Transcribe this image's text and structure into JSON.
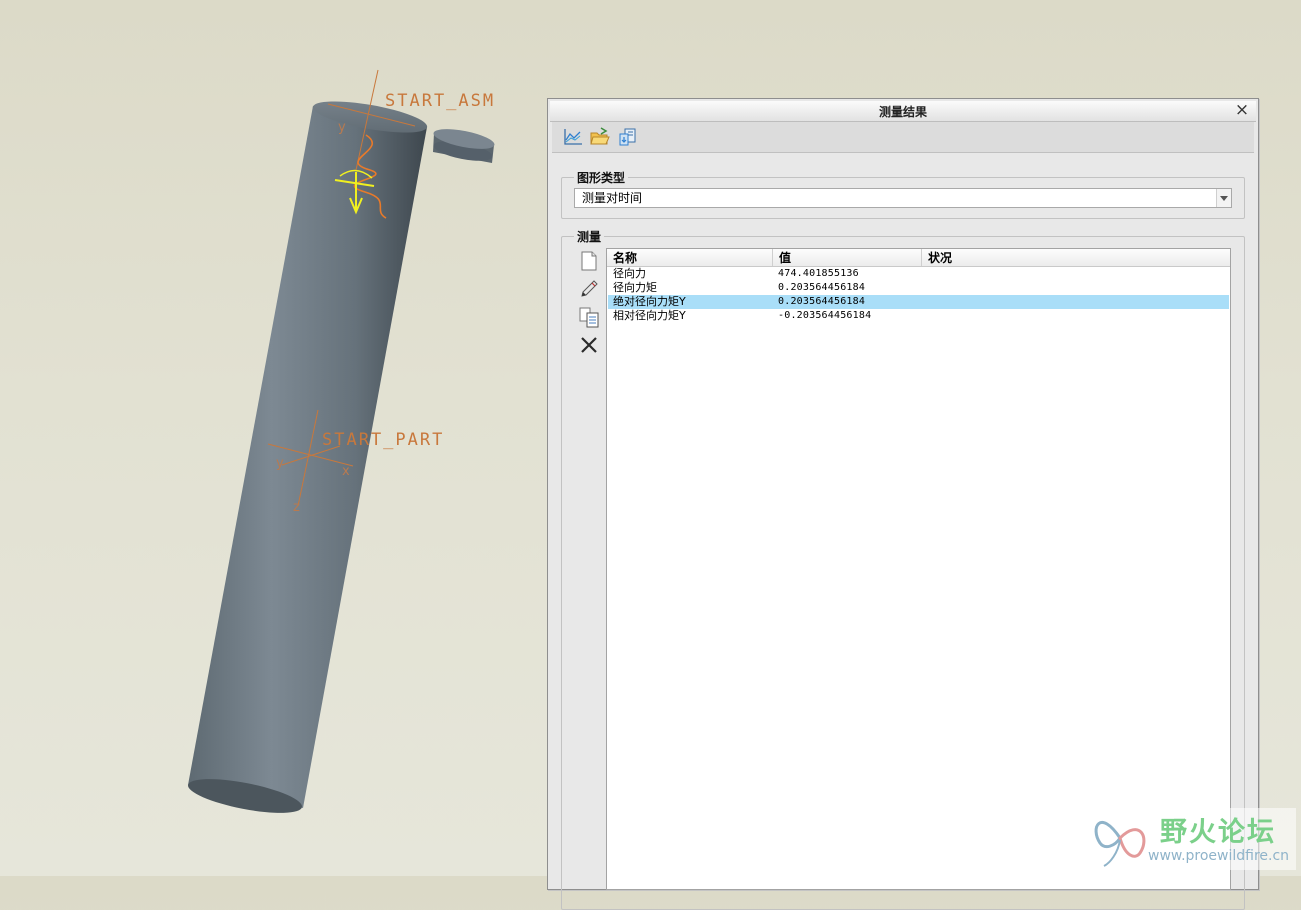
{
  "viewport": {
    "csys_top_label": "START_ASM",
    "csys_mid_label": "START_PART",
    "axis_y": "y",
    "axis_x": "x",
    "axis_z": "z",
    "cylinder_color": "#6d7a84",
    "csys_color": "#c8783c",
    "spring_color": "#e87a2a",
    "force_arrow_color": "#f0f020"
  },
  "dialog": {
    "title": "测量结果",
    "close_glyph": "×",
    "toolbar": {
      "graph_icon": "graph-icon",
      "open_icon": "open-folder-icon",
      "export_icon": "export-icon"
    },
    "graph_type": {
      "legend": "图形类型",
      "selected": "测量对时间"
    },
    "measures": {
      "legend": "测量",
      "side_buttons": [
        "new-icon",
        "edit-icon",
        "copy-icon",
        "delete-icon"
      ],
      "columns": [
        "名称",
        "值",
        "状况"
      ],
      "rows": [
        {
          "name": "径向力",
          "value": "474.401855136",
          "status": ""
        },
        {
          "name": "径向力矩",
          "value": "0.203564456184",
          "status": ""
        },
        {
          "name": "绝对径向力矩Y",
          "value": "0.203564456184",
          "status": ""
        },
        {
          "name": "相对径向力矩Y",
          "value": "-0.203564456184",
          "status": ""
        }
      ],
      "selected_row": 2,
      "selection_color": "#a9def8"
    }
  },
  "watermark": {
    "title": "野火论坛",
    "url": "www.proewildfire.cn"
  }
}
